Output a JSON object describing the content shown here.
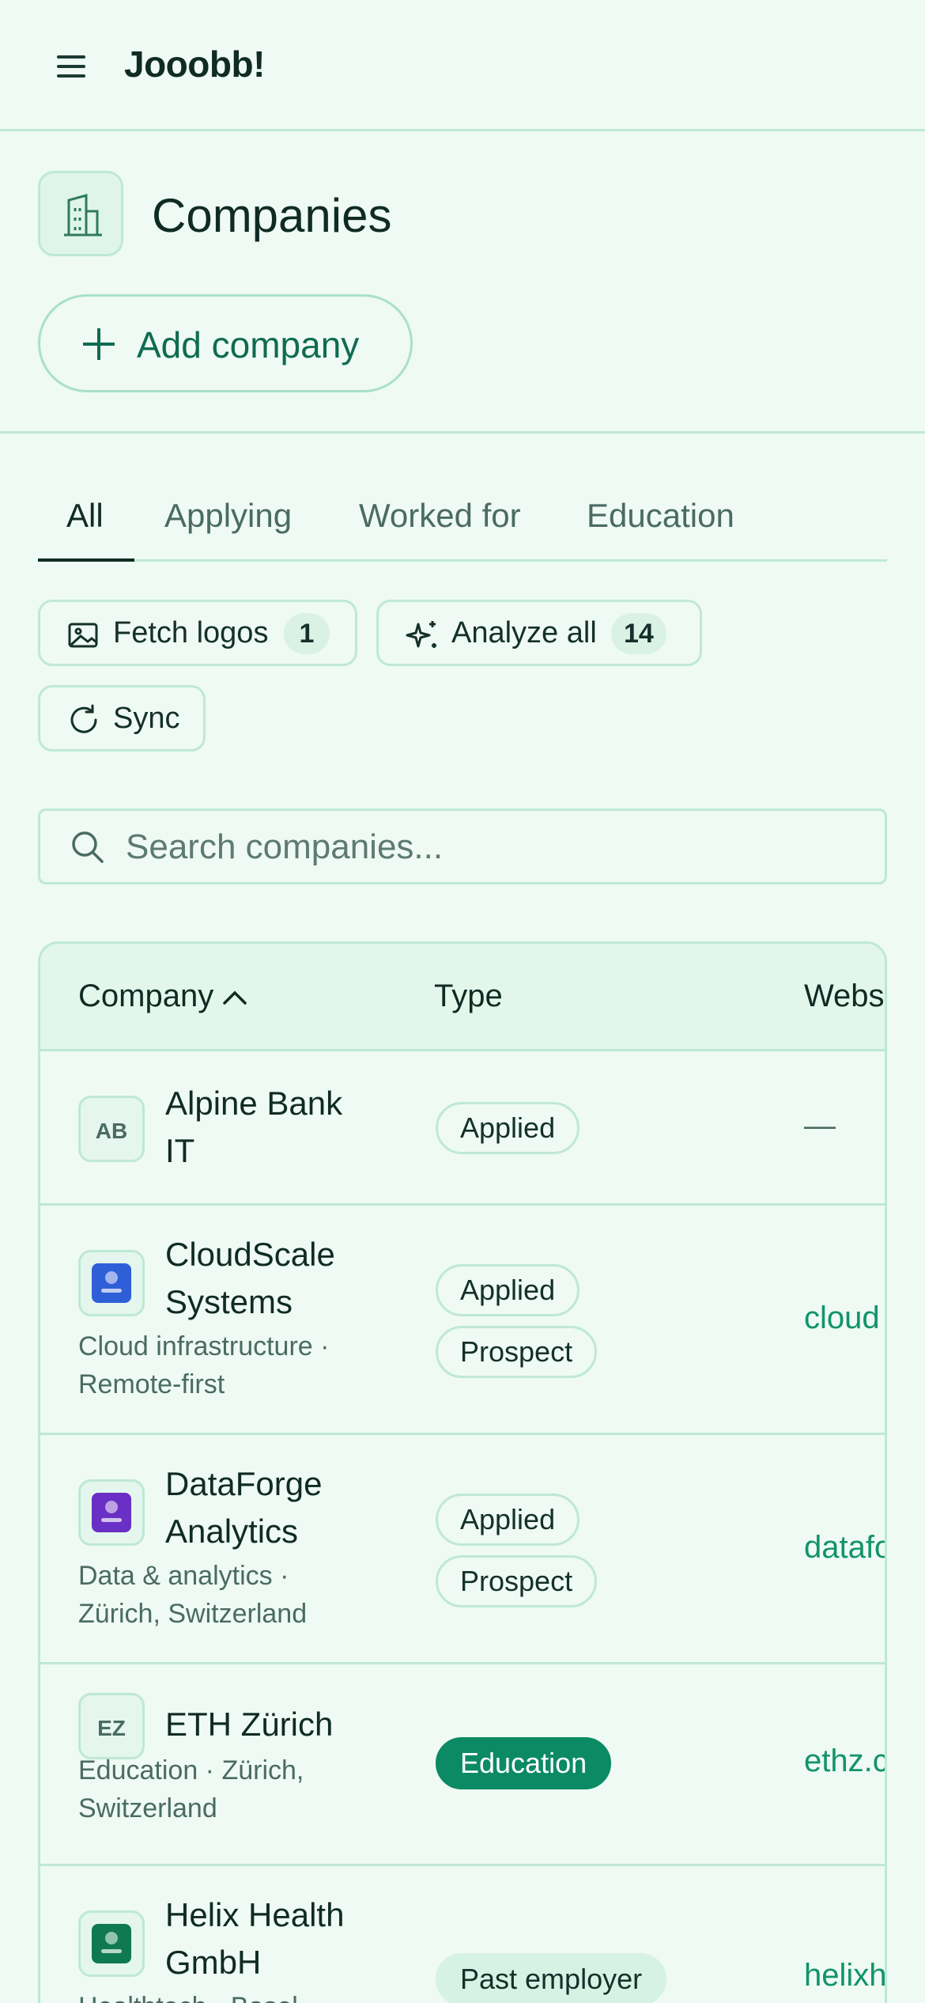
{
  "app": {
    "title": "Jooobb!"
  },
  "page": {
    "title": "Companies",
    "add_button_label": "Add company"
  },
  "tabs": [
    {
      "label": "All",
      "active": true
    },
    {
      "label": "Applying",
      "active": false
    },
    {
      "label": "Worked for",
      "active": false
    },
    {
      "label": "Education",
      "active": false
    }
  ],
  "actions": {
    "fetch_logos": {
      "label": "Fetch logos",
      "count": "1"
    },
    "analyze_all": {
      "label": "Analyze all",
      "count": "14"
    },
    "sync": {
      "label": "Sync"
    }
  },
  "search": {
    "placeholder": "Search companies...",
    "value": ""
  },
  "table": {
    "columns": [
      "Company",
      "Type",
      "Webs"
    ],
    "sort": {
      "column": "Company",
      "direction": "ascending"
    },
    "rows": [
      {
        "name_lines": [
          "Alpine Bank",
          "IT"
        ],
        "desc_lines": [],
        "logo": {
          "kind": "initials",
          "text": "AB"
        },
        "types": [
          "Applied"
        ],
        "website": "—"
      },
      {
        "name_lines": [
          "CloudScale",
          "Systems"
        ],
        "desc_lines": [
          "Cloud infrastructure ·",
          "Remote-first"
        ],
        "logo": {
          "kind": "image",
          "color": "#2f5fd8"
        },
        "types": [
          "Applied",
          "Prospect"
        ],
        "website": "cloud"
      },
      {
        "name_lines": [
          "DataForge",
          "Analytics"
        ],
        "desc_lines": [
          "Data & analytics ·",
          "Zürich, Switzerland"
        ],
        "logo": {
          "kind": "image",
          "color": "#6a2fc4"
        },
        "types": [
          "Applied",
          "Prospect"
        ],
        "website": "datafo"
      },
      {
        "name_lines": [
          "ETH Zürich"
        ],
        "desc_lines": [
          "Education · Zürich,",
          "Switzerland"
        ],
        "logo": {
          "kind": "initials",
          "text": "EZ"
        },
        "types": [
          "Education"
        ],
        "website": "ethz.c"
      },
      {
        "name_lines": [
          "Helix Health",
          "GmbH"
        ],
        "desc_lines": [
          "Healthtech · Basel"
        ],
        "logo": {
          "kind": "image",
          "color": "#0f7a52"
        },
        "types": [
          "Past employer"
        ],
        "website": "helixh"
      }
    ]
  },
  "colors": {
    "accent": "#0b8a63",
    "background": "#eefaf3",
    "border": "#bfe8d6",
    "link": "#12936b"
  }
}
